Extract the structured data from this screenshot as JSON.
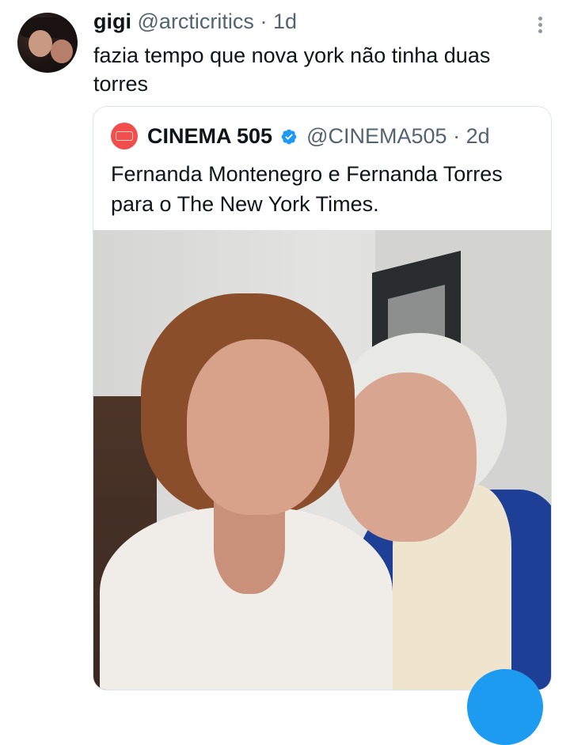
{
  "tweet": {
    "display_name": "gigi",
    "handle": "@arcticritics",
    "separator": "·",
    "time": "1d",
    "text": "fazia tempo que nova york não tinha duas torres",
    "avatar_icon": "user-avatar"
  },
  "quote": {
    "avatar_icon": "cinema505-logo",
    "display_name": "CINEMA 505",
    "verified_icon": "verified-badge-icon",
    "handle": "@CINEMA505",
    "separator": "·",
    "time": "2d",
    "text": "Fernanda Montenegro e Fernanda Torres para o The New York Times."
  },
  "colors": {
    "accent": "#1d9bf0",
    "secondary_text": "#536471",
    "border": "#dfe4e8",
    "logo_red": "#f24e4e"
  },
  "icons": {
    "more": "more-vertical-icon",
    "compose": "compose-fab"
  }
}
